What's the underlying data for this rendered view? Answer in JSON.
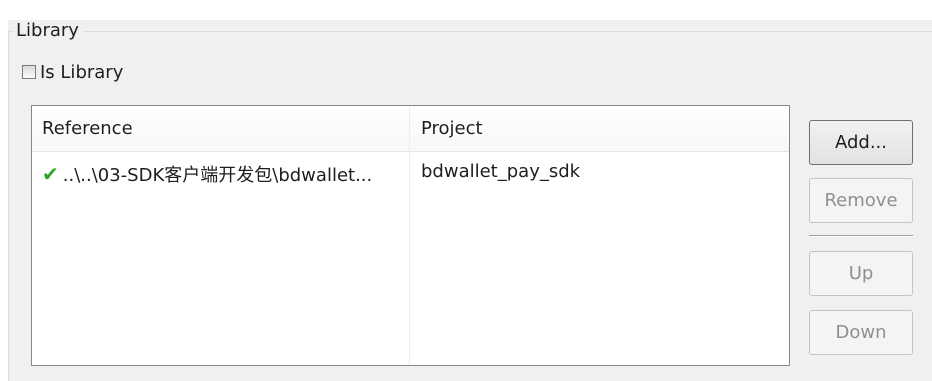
{
  "group": {
    "title": "Library"
  },
  "is_library": {
    "label": "Is Library",
    "checked": false
  },
  "table": {
    "columns": [
      "Reference",
      "Project"
    ],
    "rows": [
      {
        "reference": "..\\..\\03-SDK客户端开发包\\bdwallet...",
        "project": "bdwallet_pay_sdk",
        "status_icon": "check-icon"
      }
    ]
  },
  "buttons": {
    "add": "Add...",
    "remove": "Remove",
    "up": "Up",
    "down": "Down"
  },
  "colors": {
    "check": "#2fa428",
    "disabled_text": "#8f8f8f"
  }
}
